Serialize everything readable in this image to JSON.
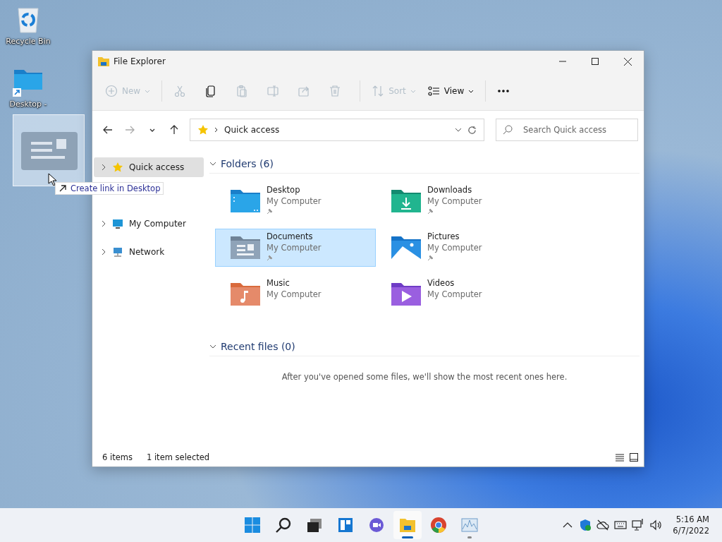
{
  "desktop_icons": [
    {
      "kind": "recycle",
      "label": "Recycle Bin"
    },
    {
      "kind": "folder-shortcut",
      "label": "Desktop -"
    }
  ],
  "drag_tooltip": {
    "label": "Create link in Desktop"
  },
  "window": {
    "title": "File Explorer"
  },
  "toolbar": [
    {
      "kind": "new",
      "label": "New",
      "disabled": true
    },
    {
      "kind": "cut",
      "disabled": true
    },
    {
      "kind": "copy",
      "disabled": false
    },
    {
      "kind": "paste",
      "disabled": true
    },
    {
      "kind": "rename",
      "disabled": true
    },
    {
      "kind": "share",
      "disabled": true
    },
    {
      "kind": "delete",
      "disabled": true
    },
    {
      "kind": "sort",
      "label": "Sort",
      "disabled": true
    },
    {
      "kind": "view",
      "label": "View",
      "disabled": false
    },
    {
      "kind": "more",
      "disabled": false
    }
  ],
  "nav": [
    {
      "kind": "back",
      "disabled": false
    },
    {
      "kind": "forward",
      "disabled": true
    },
    {
      "kind": "recent",
      "disabled": false
    },
    {
      "kind": "up",
      "disabled": false
    }
  ],
  "address": {
    "location": "Quick access"
  },
  "search": {
    "placeholder": "Search Quick access"
  },
  "sidebar": {
    "items": [
      {
        "kind": "star",
        "label": "Quick access",
        "selected": true,
        "expanded": false
      },
      {
        "kind": "computer",
        "label": "My Computer",
        "selected": false,
        "expanded": false
      },
      {
        "kind": "network",
        "label": "Network",
        "selected": false,
        "expanded": false
      }
    ]
  },
  "folders": {
    "heading": "Folders (6)",
    "expanded": true,
    "items": [
      {
        "kind": "desktop",
        "name": "Desktop",
        "location": "My Computer",
        "pinned": true,
        "selected": false
      },
      {
        "kind": "downloads",
        "name": "Downloads",
        "location": "My Computer",
        "pinned": true,
        "selected": false
      },
      {
        "kind": "documents",
        "name": "Documents",
        "location": "My Computer",
        "pinned": true,
        "selected": true
      },
      {
        "kind": "pictures",
        "name": "Pictures",
        "location": "My Computer",
        "pinned": true,
        "selected": false
      },
      {
        "kind": "music",
        "name": "Music",
        "location": "My Computer",
        "pinned": false,
        "selected": false
      },
      {
        "kind": "videos",
        "name": "Videos",
        "location": "My Computer",
        "pinned": false,
        "selected": false
      }
    ]
  },
  "recent": {
    "heading": "Recent files (0)",
    "expanded": true,
    "empty_message": "After you've opened some files, we'll show the most recent ones here."
  },
  "status_bar": {
    "count": "6 items",
    "selection": "1 item selected"
  },
  "taskbar": {
    "apps": [
      {
        "kind": "start",
        "active": false
      },
      {
        "kind": "search",
        "active": false
      },
      {
        "kind": "taskview",
        "active": false
      },
      {
        "kind": "widgets",
        "active": false
      },
      {
        "kind": "chat",
        "active": false
      },
      {
        "kind": "explorer",
        "active": true
      },
      {
        "kind": "browser",
        "active": false
      },
      {
        "kind": "monitor",
        "running": true,
        "active": false
      }
    ],
    "tray": [
      {
        "kind": "chevron"
      },
      {
        "kind": "shield"
      },
      {
        "kind": "cloud"
      },
      {
        "kind": "keyboard"
      },
      {
        "kind": "network"
      },
      {
        "kind": "volume"
      }
    ],
    "time": "5:16 AM",
    "date": "6/7/2022"
  }
}
